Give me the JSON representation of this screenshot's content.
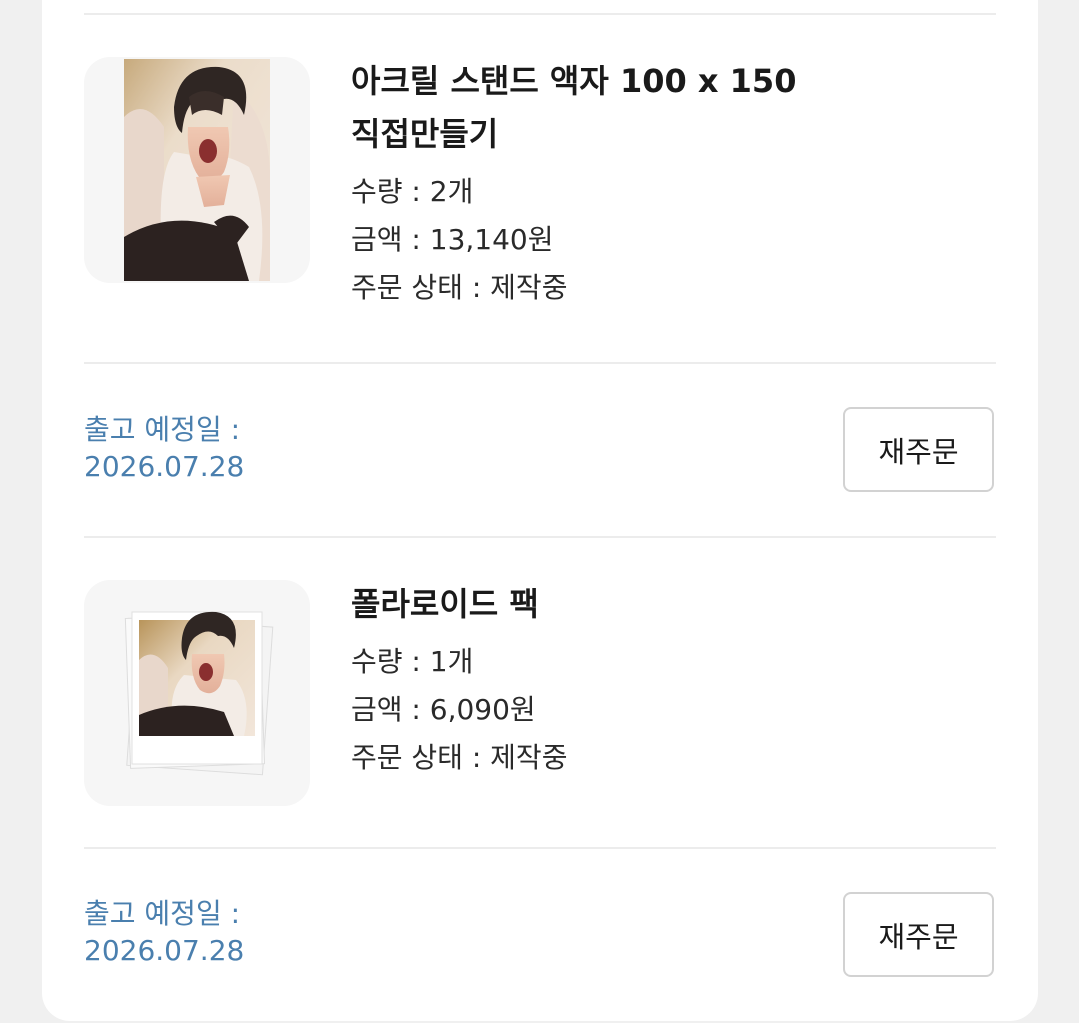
{
  "orders": [
    {
      "title_line1": "아크릴 스탠드 액자 100 x 150",
      "title_line2": "직접만들기",
      "quantity": "수량 : 2개",
      "amount": "금액 : 13,140원",
      "status": "주문 상태 : 제작중",
      "ship_label": "출고 예정일 :",
      "ship_date": "2026.07.28",
      "reorder_label": "재주문",
      "thumbnail_icon": "acrylic-stand-photo-icon"
    },
    {
      "title_line1": "폴라로이드 팩",
      "quantity": "수량 : 1개",
      "amount": "금액 : 6,090원",
      "status": "주문 상태 : 제작중",
      "ship_label": "출고 예정일 :",
      "ship_date": "2026.07.28",
      "reorder_label": "재주문",
      "thumbnail_icon": "polaroid-pack-photo-icon"
    }
  ],
  "colors": {
    "ship_text": "#4a7fae",
    "divider": "#ececec",
    "button_border": "#d2d2d2"
  }
}
